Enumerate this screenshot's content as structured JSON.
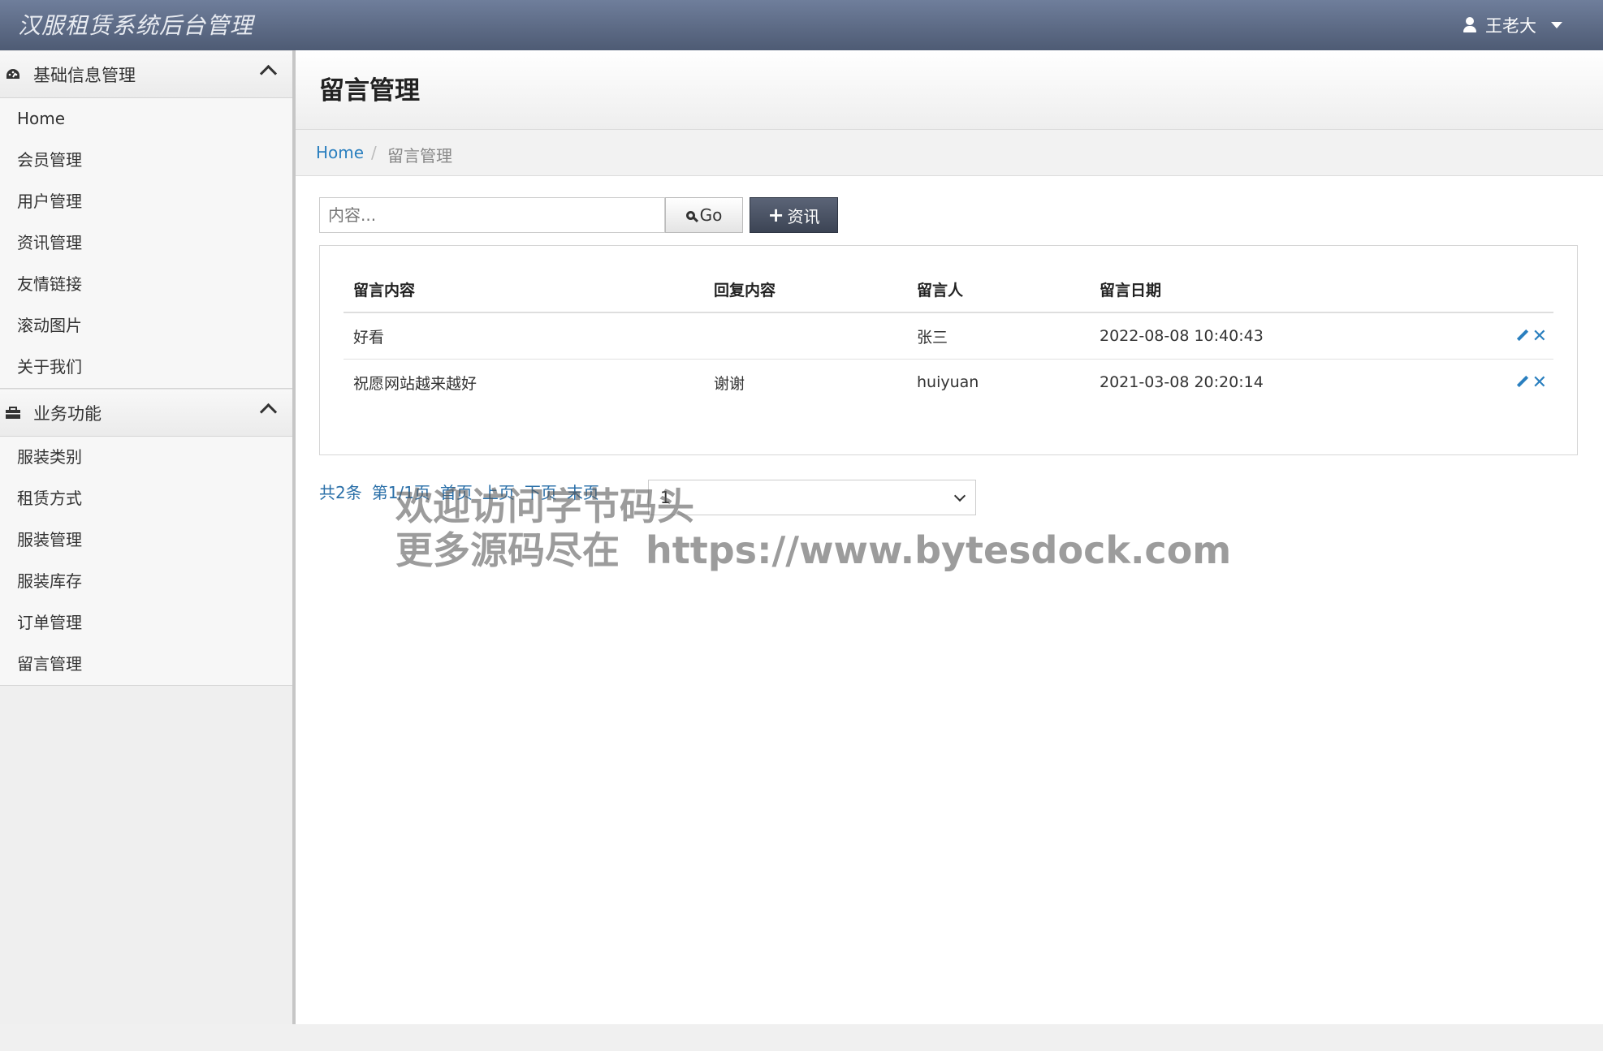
{
  "header": {
    "brand": "汉服租赁系统后台管理",
    "user_name": "王老大"
  },
  "sidebar": {
    "groups": [
      {
        "title": "基础信息管理",
        "icon": "dashboard-icon",
        "items": [
          "Home",
          "会员管理",
          "用户管理",
          "资讯管理",
          "友情链接",
          "滚动图片",
          "关于我们"
        ]
      },
      {
        "title": "业务功能",
        "icon": "briefcase-icon",
        "items": [
          "服装类别",
          "租赁方式",
          "服装管理",
          "服装库存",
          "订单管理",
          "留言管理"
        ]
      }
    ]
  },
  "page": {
    "title": "留言管理"
  },
  "breadcrumb": {
    "home": "Home",
    "separator": "/",
    "current": "留言管理"
  },
  "search": {
    "placeholder": "内容...",
    "go_label": "Go",
    "add_label": "资讯"
  },
  "table": {
    "columns": [
      "留言内容",
      "回复内容",
      "留言人",
      "留言日期"
    ],
    "rows": [
      {
        "content": "好看",
        "reply": "",
        "author": "张三",
        "date": "2022-08-08 10:40:43"
      },
      {
        "content": "祝愿网站越来越好",
        "reply": "谢谢",
        "author": "huiyuan",
        "date": "2021-03-08 20:20:14"
      }
    ]
  },
  "pager": {
    "total": "共2条",
    "page_info": "第1/1页",
    "first": "首页",
    "prev": "上页",
    "next": "下页",
    "last": "末页",
    "selected_page": "1"
  },
  "watermark": {
    "line1": "欢迎访问字节码头",
    "line2": "更多源码尽在  https://www.bytesdock.com"
  },
  "colors": {
    "accent": "#2a7fbf",
    "topbar": "#5f6d88",
    "add_button": "#4a5263"
  }
}
